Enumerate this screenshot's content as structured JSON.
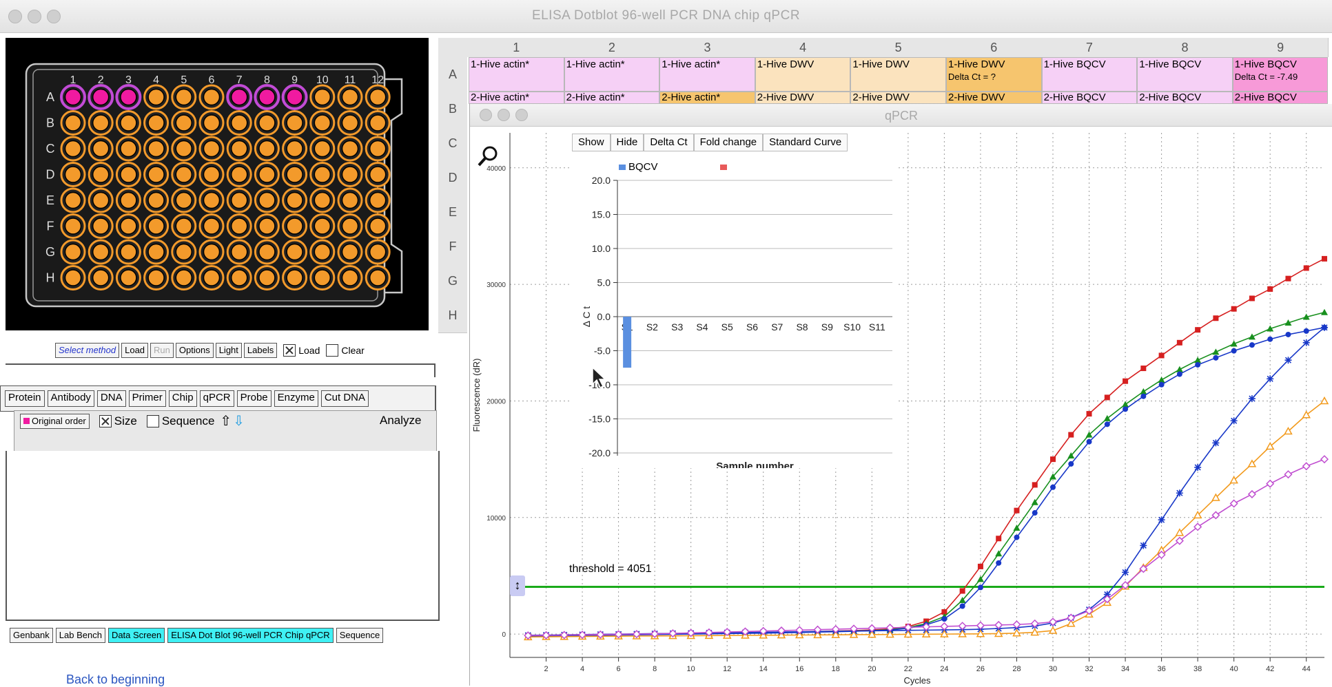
{
  "window": {
    "title": "ELISA  Dotblot  96-well PCR  DNA chip  qPCR"
  },
  "plate": {
    "column_labels": [
      "1",
      "2",
      "3",
      "4",
      "5",
      "6",
      "7",
      "8",
      "9",
      "10",
      "11",
      "12"
    ],
    "row_labels": [
      "A",
      "B",
      "C",
      "D",
      "E",
      "F",
      "G",
      "H"
    ],
    "highlighted_wells": [
      "A1",
      "A2",
      "A3",
      "A7",
      "A8",
      "A9"
    ],
    "colors": {
      "well": "#f39a2b",
      "highlight": "#f01aa0",
      "ring_highlight": "#c24bd6"
    }
  },
  "method_toolbar": {
    "select_method": "Select method",
    "load": "Load",
    "run": "Run",
    "options": "Options",
    "light": "Light",
    "labels": "Labels",
    "load_check": "Load",
    "clear_check": "Clear"
  },
  "categories": [
    "Protein",
    "Antibody",
    "DNA",
    "Primer",
    "Chip",
    "qPCR",
    "Probe",
    "Enzyme",
    "Cut DNA"
  ],
  "sort_bar": {
    "original_order": "Original order",
    "size": "Size",
    "sequence": "Sequence",
    "analyze": "Analyze"
  },
  "bottom_buttons": [
    "Genbank",
    "Lab Bench",
    "Data Screen",
    "ELISA  Dot Blot  96-well PCR  Chip  qPCR",
    "Sequence"
  ],
  "back_link": "Back to beginning",
  "sheet": {
    "columns": [
      "1",
      "2",
      "3",
      "4",
      "5",
      "6",
      "7",
      "8",
      "9"
    ],
    "rows": [
      "A",
      "B",
      "C",
      "D",
      "E",
      "F",
      "G",
      "H"
    ],
    "row_a": [
      {
        "text": "1-Hive actin*",
        "note": "",
        "color": "#f6d0f6"
      },
      {
        "text": "1-Hive actin*",
        "note": "",
        "color": "#f6d0f6"
      },
      {
        "text": "1-Hive actin*",
        "note": "",
        "color": "#f6d0f6"
      },
      {
        "text": "1-Hive DWV",
        "note": "",
        "color": "#fbe3be"
      },
      {
        "text": "1-Hive DWV",
        "note": "",
        "color": "#fbe3be"
      },
      {
        "text": "1-Hive DWV",
        "note": "Delta Ct = ?",
        "color": "#f6c56e"
      },
      {
        "text": "1-Hive BQCV",
        "note": "",
        "color": "#f6d0f6"
      },
      {
        "text": "1-Hive BQCV",
        "note": "",
        "color": "#f6d0f6"
      },
      {
        "text": "1-Hive BQCV",
        "note": "Delta Ct = -7.49",
        "color": "#f79ad8"
      }
    ],
    "row_b": [
      {
        "text": "2-Hive actin*",
        "color": "#f6d0f6"
      },
      {
        "text": "2-Hive actin*",
        "color": "#f6d0f6"
      },
      {
        "text": "2-Hive actin*",
        "color": "#f6c56e"
      },
      {
        "text": "2-Hive DWV",
        "color": "#fbe3be"
      },
      {
        "text": "2-Hive DWV",
        "color": "#fbe3be"
      },
      {
        "text": "2-Hive DWV",
        "color": "#f6c56e"
      },
      {
        "text": "2-Hive BQCV",
        "color": "#f6d0f6"
      },
      {
        "text": "2-Hive BQCV",
        "color": "#f6d0f6"
      },
      {
        "text": "2-Hive BQCV",
        "color": "#f79ad8"
      }
    ]
  },
  "qpcr": {
    "title": "qPCR",
    "tabs": [
      "Show",
      "Hide",
      "Delta Ct",
      "Fold change",
      "Standard Curve"
    ],
    "threshold_label": "threshold = 4051"
  },
  "chart_data": [
    {
      "type": "line",
      "xlabel": "Cycles",
      "ylabel": "Fluorescence (dR)",
      "xlim": [
        0,
        45
      ],
      "ylim": [
        -2000,
        43000
      ],
      "x_ticks": [
        2,
        4,
        6,
        8,
        10,
        12,
        14,
        16,
        18,
        20,
        22,
        24,
        26,
        28,
        30,
        32,
        34,
        36,
        38,
        40,
        42,
        44
      ],
      "y_ticks": [
        0,
        10000,
        20000,
        30000,
        40000
      ],
      "grid": true,
      "threshold": 4051,
      "threshold_color": "#1aaa1a",
      "series": [
        {
          "color": "#d62020",
          "marker": "square",
          "x": [
            1,
            2,
            3,
            4,
            5,
            6,
            7,
            8,
            9,
            10,
            11,
            12,
            13,
            14,
            15,
            16,
            17,
            18,
            19,
            20,
            21,
            22,
            23,
            24,
            25,
            26,
            27,
            28,
            29,
            30,
            31,
            32,
            33,
            34,
            35,
            36,
            37,
            38,
            39,
            40,
            41,
            42,
            43,
            44,
            45
          ],
          "y": [
            -150,
            -120,
            -100,
            -80,
            -60,
            -40,
            -20,
            0,
            20,
            40,
            60,
            80,
            100,
            130,
            160,
            190,
            220,
            260,
            300,
            360,
            450,
            650,
            1100,
            1900,
            3700,
            5800,
            8200,
            10600,
            12800,
            15000,
            17100,
            18900,
            20300,
            21700,
            22800,
            23900,
            25000,
            26100,
            27100,
            27900,
            28800,
            29600,
            30500,
            31400,
            32200
          ]
        },
        {
          "color": "#18901e",
          "marker": "triangle",
          "x": [
            1,
            2,
            3,
            4,
            5,
            6,
            7,
            8,
            9,
            10,
            11,
            12,
            13,
            14,
            15,
            16,
            17,
            18,
            19,
            20,
            21,
            22,
            23,
            24,
            25,
            26,
            27,
            28,
            29,
            30,
            31,
            32,
            33,
            34,
            35,
            36,
            37,
            38,
            39,
            40,
            41,
            42,
            43,
            44,
            45
          ],
          "y": [
            -180,
            -150,
            -120,
            -100,
            -80,
            -60,
            -40,
            -20,
            0,
            20,
            40,
            60,
            80,
            100,
            130,
            160,
            190,
            220,
            260,
            300,
            380,
            560,
            900,
            1500,
            2900,
            4700,
            6900,
            9100,
            11300,
            13500,
            15300,
            17100,
            18500,
            19700,
            20800,
            21800,
            22700,
            23500,
            24200,
            24900,
            25500,
            26200,
            26700,
            27200,
            27600
          ]
        },
        {
          "color": "#1838c8",
          "marker": "circle",
          "x": [
            1,
            2,
            3,
            4,
            5,
            6,
            7,
            8,
            9,
            10,
            11,
            12,
            13,
            14,
            15,
            16,
            17,
            18,
            19,
            20,
            21,
            22,
            23,
            24,
            25,
            26,
            27,
            28,
            29,
            30,
            31,
            32,
            33,
            34,
            35,
            36,
            37,
            38,
            39,
            40,
            41,
            42,
            43,
            44,
            45
          ],
          "y": [
            -200,
            -170,
            -150,
            -120,
            -100,
            -80,
            -60,
            -40,
            -20,
            0,
            20,
            40,
            60,
            80,
            110,
            140,
            170,
            200,
            240,
            290,
            350,
            500,
            800,
            1300,
            2400,
            4000,
            6100,
            8300,
            10400,
            12600,
            14600,
            16500,
            18000,
            19300,
            20400,
            21400,
            22300,
            23100,
            23700,
            24300,
            24800,
            25300,
            25700,
            26000,
            26300
          ]
        },
        {
          "color": "#1838c8",
          "marker": "asterisk",
          "x": [
            1,
            2,
            3,
            4,
            5,
            6,
            7,
            8,
            9,
            10,
            11,
            12,
            13,
            14,
            15,
            16,
            17,
            18,
            19,
            20,
            21,
            22,
            23,
            24,
            25,
            26,
            27,
            28,
            29,
            30,
            31,
            32,
            33,
            34,
            35,
            36,
            37,
            38,
            39,
            40,
            41,
            42,
            43,
            44,
            45
          ],
          "y": [
            -100,
            -80,
            -60,
            -40,
            -20,
            0,
            20,
            40,
            60,
            80,
            100,
            120,
            140,
            160,
            180,
            200,
            220,
            240,
            260,
            280,
            300,
            320,
            340,
            360,
            380,
            420,
            480,
            560,
            700,
            950,
            1400,
            2100,
            3400,
            5300,
            7600,
            9800,
            12100,
            14300,
            16400,
            18300,
            20200,
            21900,
            23500,
            25000,
            26300
          ]
        },
        {
          "color": "#f29a1c",
          "marker": "triangle-open",
          "x": [
            1,
            2,
            3,
            4,
            5,
            6,
            7,
            8,
            9,
            10,
            11,
            12,
            13,
            14,
            15,
            16,
            17,
            18,
            19,
            20,
            21,
            22,
            23,
            24,
            25,
            26,
            27,
            28,
            29,
            30,
            31,
            32,
            33,
            34,
            35,
            36,
            37,
            38,
            39,
            40,
            41,
            42,
            43,
            44,
            45
          ],
          "y": [
            -250,
            -230,
            -220,
            -200,
            -190,
            -180,
            -170,
            -160,
            -150,
            -140,
            -130,
            -120,
            -110,
            -100,
            -90,
            -80,
            -70,
            -60,
            -50,
            -40,
            -30,
            -20,
            -10,
            0,
            10,
            20,
            40,
            80,
            150,
            300,
            900,
            1700,
            2700,
            4100,
            5700,
            7200,
            8700,
            10200,
            11700,
            13200,
            14600,
            16100,
            17400,
            18800,
            20000
          ]
        },
        {
          "color": "#c04ed0",
          "marker": "diamond-open",
          "x": [
            1,
            2,
            3,
            4,
            5,
            6,
            7,
            8,
            9,
            10,
            11,
            12,
            13,
            14,
            15,
            16,
            17,
            18,
            19,
            20,
            21,
            22,
            23,
            24,
            25,
            26,
            27,
            28,
            29,
            30,
            31,
            32,
            33,
            34,
            35,
            36,
            37,
            38,
            39,
            40,
            41,
            42,
            43,
            44,
            45
          ],
          "y": [
            -120,
            -100,
            -80,
            -60,
            -40,
            -20,
            0,
            20,
            60,
            100,
            140,
            180,
            220,
            260,
            300,
            340,
            380,
            420,
            460,
            500,
            540,
            580,
            620,
            660,
            700,
            740,
            780,
            820,
            900,
            1050,
            1400,
            2000,
            3000,
            4200,
            5600,
            6800,
            8000,
            9200,
            10200,
            11200,
            12000,
            12900,
            13700,
            14400,
            15000
          ]
        }
      ]
    },
    {
      "type": "bar",
      "xlabel": "Sample number",
      "ylabel": "Δ C t",
      "categories": [
        "S1",
        "S2",
        "S3",
        "S4",
        "S5",
        "S6",
        "S7",
        "S8",
        "S9",
        "S10",
        "S11"
      ],
      "ylim": [
        -20,
        20
      ],
      "y_ticks": [
        20.0,
        15.0,
        10.0,
        5.0,
        0.0,
        -5.0,
        -10.0,
        -15.0,
        -20.0
      ],
      "y_tick_labels": [
        "20.0",
        "15.0",
        "10.0",
        "5.0",
        "0.0",
        "-5.0",
        "-10.0",
        "-15.0",
        "-20.0"
      ],
      "grid": true,
      "legend": [
        "BQCV",
        ""
      ],
      "legend_colors": [
        "#5a8fe0",
        "#e85a5a"
      ],
      "series": [
        {
          "name": "BQCV",
          "color": "#5a8fe0",
          "values": [
            -7.49,
            0,
            0,
            0,
            0,
            0,
            0,
            0,
            0,
            0,
            0
          ]
        }
      ]
    }
  ]
}
